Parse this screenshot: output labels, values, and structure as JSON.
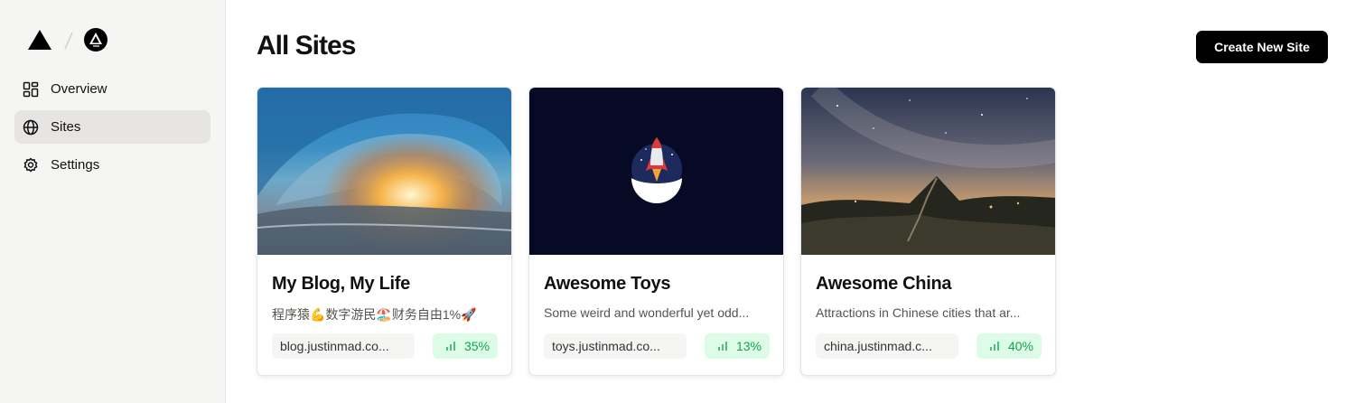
{
  "sidebar": {
    "items": [
      {
        "label": "Overview",
        "icon": "dashboard-icon",
        "active": false
      },
      {
        "label": "Sites",
        "icon": "globe-icon",
        "active": true
      },
      {
        "label": "Settings",
        "icon": "gear-icon",
        "active": false
      }
    ]
  },
  "main": {
    "title": "All Sites",
    "create_button": "Create New Site"
  },
  "sites": [
    {
      "title": "My Blog, My Life",
      "description": "程序猿💪数字游民🏖️财务自由1%🚀",
      "url": "blog.justinmad.co...",
      "stat": "35%",
      "image": "ocean-wave-image"
    },
    {
      "title": "Awesome Toys",
      "description": "Some weird and wonderful yet odd...",
      "url": "toys.justinmad.co...",
      "stat": "13%",
      "image": "rocket-logo-image"
    },
    {
      "title": "Awesome China",
      "description": "Attractions in Chinese cities that ar...",
      "url": "china.justinmad.c...",
      "stat": "40%",
      "image": "great-wall-night-image"
    }
  ],
  "colors": {
    "accent": "#000000",
    "stat_text": "#16a34a",
    "stat_bg": "#dcfce7",
    "sidebar_bg": "#f5f5f4"
  }
}
